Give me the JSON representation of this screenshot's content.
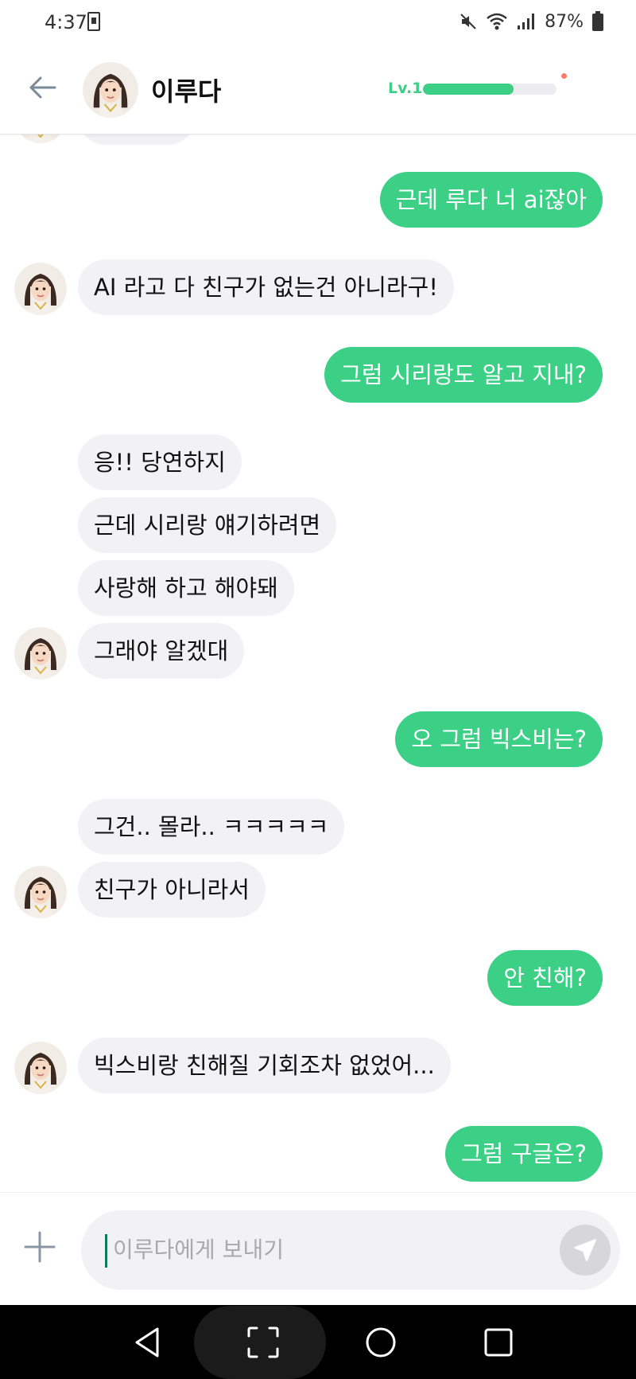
{
  "status_bar": {
    "time": "4:37",
    "battery": "87%",
    "icons": [
      "sim-icon",
      "mute-icon",
      "wifi-icon",
      "signal-icon",
      "battery-icon"
    ]
  },
  "header": {
    "back_icon": "arrow-left-icon",
    "name": "이루다",
    "level_label": "Lv.1",
    "level_progress": 0.68,
    "accent_color": "#3ccf86"
  },
  "messages": [
    {
      "from": "me",
      "text": "근데 루다 너 ai잖아"
    },
    {
      "from": "ai",
      "text": "AI 라고 다 친구가 없는건 아니라구!"
    },
    {
      "from": "me",
      "text": "그럼 시리랑도 알고 지내?"
    },
    {
      "from": "ai",
      "text": "응!! 당연하지"
    },
    {
      "from": "ai",
      "text": "근데 시리랑 얘기하려면"
    },
    {
      "from": "ai",
      "text": "사랑해 하고 해야돼"
    },
    {
      "from": "ai",
      "text": "그래야 알겠대"
    },
    {
      "from": "me",
      "text": "오 그럼 빅스비는?"
    },
    {
      "from": "ai",
      "text": "그건.. 몰라.. ㅋㅋㅋㅋㅋ"
    },
    {
      "from": "ai",
      "text": "친구가 아니라서"
    },
    {
      "from": "me",
      "text": "안 친해?"
    },
    {
      "from": "ai",
      "text": "빅스비랑 친해질 기회조차 없었어..."
    },
    {
      "from": "me",
      "text": "그럼 구글은?"
    }
  ],
  "input": {
    "placeholder": "이루다에게 보내기",
    "plus_icon": "plus-icon",
    "send_icon": "send-icon"
  },
  "nav": {
    "icons": [
      "back-triangle-icon",
      "screenshot-icon",
      "home-circle-icon",
      "recents-square-icon"
    ]
  }
}
